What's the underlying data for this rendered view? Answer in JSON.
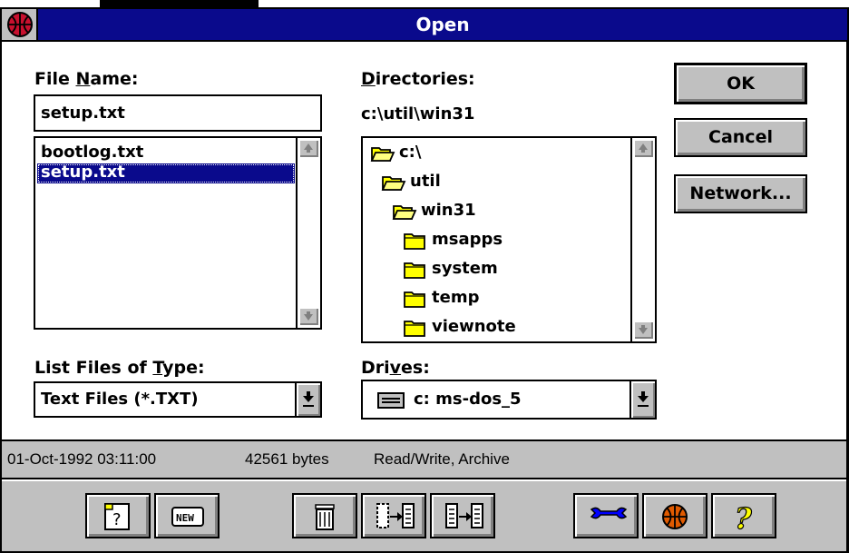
{
  "window": {
    "title": "Open"
  },
  "file_name": {
    "label_pre": "File ",
    "label_u": "N",
    "label_post": "ame:",
    "value": "setup.txt",
    "files": [
      "bootlog.txt",
      "setup.txt"
    ],
    "selected_index": 1
  },
  "directories": {
    "label_u": "D",
    "label_post": "irectories:",
    "current_path": "c:\\util\\win31",
    "items": [
      {
        "name": "c:\\",
        "icon": "open-folder-icon"
      },
      {
        "name": "util",
        "icon": "open-folder-icon"
      },
      {
        "name": "win31",
        "icon": "open-folder-icon"
      },
      {
        "name": "msapps",
        "icon": "folder-icon"
      },
      {
        "name": "system",
        "icon": "folder-icon"
      },
      {
        "name": "temp",
        "icon": "folder-icon"
      },
      {
        "name": "viewnote",
        "icon": "folder-icon"
      }
    ]
  },
  "file_type": {
    "label_pre": "List Files of ",
    "label_u": "T",
    "label_post": "ype:",
    "value": "Text Files (*.TXT)"
  },
  "drives": {
    "label_pre": "Dri",
    "label_u": "v",
    "label_post": "es:",
    "value": "c: ms-dos_5",
    "icon": "drive-icon"
  },
  "buttons": {
    "ok": "OK",
    "cancel": "Cancel",
    "network": "Network..."
  },
  "status": {
    "date": "01-Oct-1992 03:11:00",
    "size": "42561 bytes",
    "attributes": "Read/Write, Archive"
  },
  "toolbar": {
    "items": [
      "help-query-icon",
      "new-icon",
      "trash-icon",
      "copy-file-icon",
      "move-file-icon",
      "wrench-icon",
      "app-logo-icon",
      "question-mark-icon"
    ]
  },
  "colors": {
    "title_bar": "#0a0a8c",
    "face": "#c0c0c0",
    "selection": "#0a0a8c"
  }
}
